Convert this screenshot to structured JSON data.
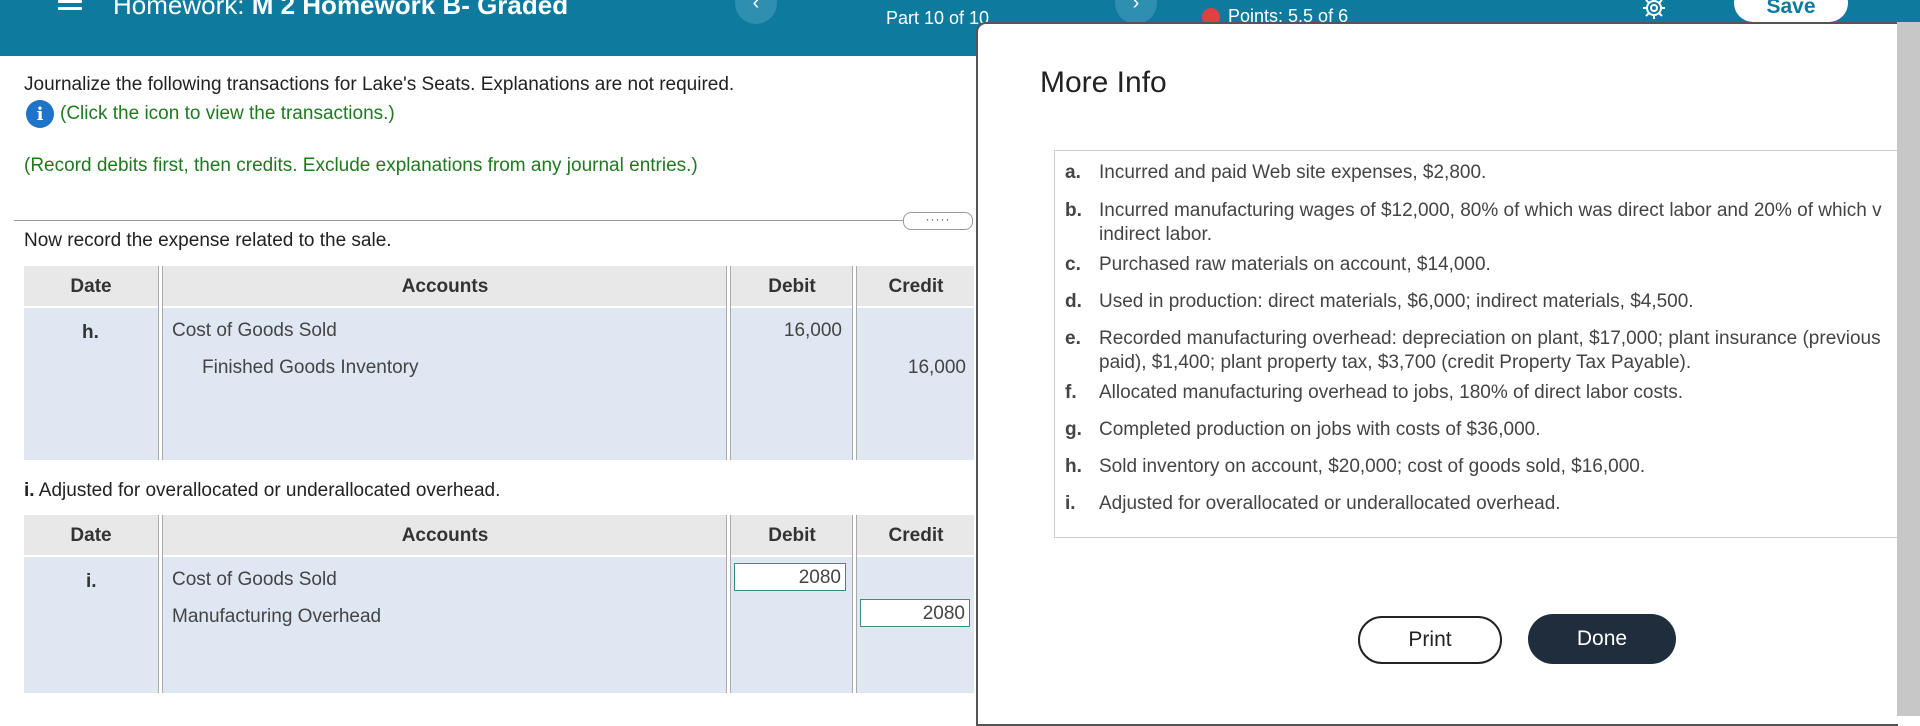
{
  "header": {
    "title_prefix": "Homework:",
    "title_name": "M 2 Homework B- Graded",
    "part": "Part 10 of 10",
    "points": "Points: 5.5 of 6",
    "save_label": "Save"
  },
  "left": {
    "instruction": "Journalize the following transactions for Lake's Seats. Explanations are not required.",
    "info_link": "(Click the icon to view the transactions.)",
    "note": "(Record debits first, then credits. Exclude explanations from any journal entries.)",
    "dots": "·····",
    "section_h": "Now record the expense related to the sale.",
    "section_i_letter": "i.",
    "section_i_text": " Adjusted for overallocated or underallocated overhead.",
    "columns": {
      "date": "Date",
      "accounts": "Accounts",
      "debit": "Debit",
      "credit": "Credit"
    },
    "entry_h": {
      "date": "h.",
      "debit_account": "Cost of Goods Sold",
      "credit_account": "Finished Goods Inventory",
      "debit": "16,000",
      "credit": "16,000"
    },
    "entry_i": {
      "date": "i.",
      "debit_account": "Cost of Goods Sold",
      "credit_account": "Manufacturing Overhead",
      "debit": "2080",
      "credit": "2080"
    }
  },
  "modal": {
    "title": "More Info",
    "items": [
      {
        "letter": "a.",
        "text": "Incurred and paid Web site expenses, $2,800."
      },
      {
        "letter": "b.",
        "text": "Incurred manufacturing wages of $12,000, 80% of which was direct labor and 20% of which v",
        "text2": "indirect labor."
      },
      {
        "letter": "c.",
        "text": "Purchased raw materials on account, $14,000."
      },
      {
        "letter": "d.",
        "text": "Used in production: direct materials, $6,000; indirect materials, $4,500."
      },
      {
        "letter": "e.",
        "text": "Recorded manufacturing overhead: depreciation on plant, $17,000; plant insurance (previous",
        "text2": "paid), $1,400; plant property tax, $3,700 (credit Property Tax Payable)."
      },
      {
        "letter": "f.",
        "text": "Allocated manufacturing overhead to jobs, 180% of direct labor costs."
      },
      {
        "letter": "g.",
        "text": "Completed production on jobs with costs of $36,000."
      },
      {
        "letter": "h.",
        "text": "Sold inventory on account, $20,000; cost of goods sold, $16,000."
      },
      {
        "letter": "i.",
        "text": "Adjusted for overallocated or underallocated overhead."
      }
    ],
    "print_label": "Print",
    "done_label": "Done"
  },
  "icons": {
    "menu": "hamburger-menu-icon",
    "back": "chevron-left-icon",
    "next": "chevron-right-icon",
    "info": "info-icon",
    "gear": "gear-icon",
    "points": "points-status-icon"
  },
  "colors": {
    "header": "#0e7a9e",
    "green_text": "#1e7a1e",
    "done_button": "#1f2d3d"
  }
}
